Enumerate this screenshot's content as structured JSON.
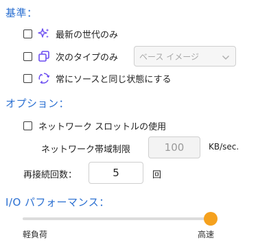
{
  "colors": {
    "accent": "#2a6fd1",
    "icon": "#6a4cf0",
    "thumb": "#f5a11e"
  },
  "standard": {
    "title": "基準：",
    "options": [
      {
        "label": "最新の世代のみ",
        "icon": "sparkles-icon",
        "checked": false
      },
      {
        "label": "次のタイプのみ",
        "icon": "copy-icon",
        "checked": false
      },
      {
        "label": "常にソースと同じ状態にする",
        "icon": "sync-icon",
        "checked": false
      }
    ],
    "type_select": {
      "value": "ベース イメージ"
    }
  },
  "options_section": {
    "title": "オプション：",
    "throttle": {
      "label": "ネットワーク スロットルの使用",
      "checked": false
    },
    "bandwidth": {
      "label": "ネットワーク帯域制限",
      "value": "100",
      "unit": "KB/sec."
    },
    "retry": {
      "label": "再接続回数：",
      "value": "5",
      "unit": "回"
    }
  },
  "io": {
    "title": "I/O パフォーマンス：",
    "level": 1.0,
    "min_label": "軽負荷",
    "max_label": "高速"
  }
}
